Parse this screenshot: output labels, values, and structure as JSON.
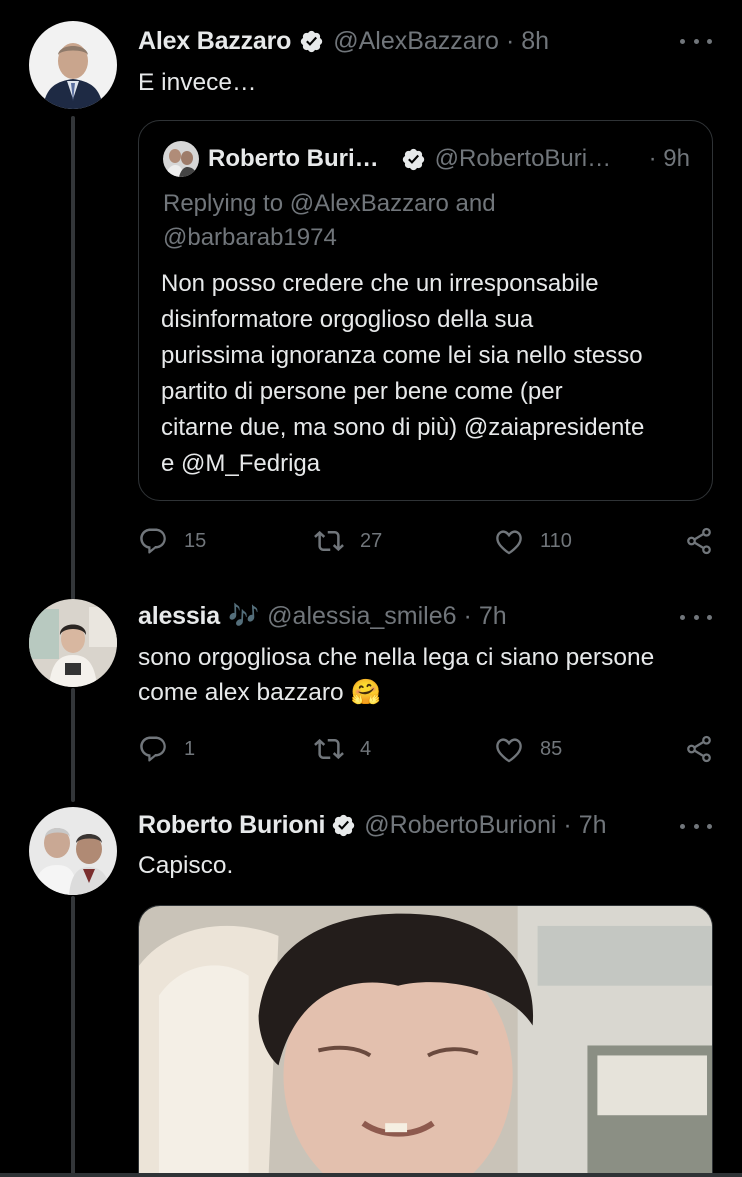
{
  "tweets": [
    {
      "name": "Alex Bazzaro",
      "handle": "@AlexBazzaro",
      "sep": "·",
      "time": "8h",
      "text": "E invece…",
      "quote": {
        "name": "Roberto Buri…",
        "handle": "@RobertoBuri…",
        "time": "· 9h",
        "replying_to_line1": "Replying to @AlexBazzaro and",
        "replying_to_line2": "@barbarab1974",
        "lines": [
          "Non posso credere che un irresponsabile",
          "disinformatore orgoglioso della sua",
          "purissima ignoranza come lei sia nello stesso",
          "partito di persone per bene come (per",
          "citarne due, ma sono di più) @zaiapresidente",
          "e @M_Fedriga"
        ]
      },
      "replies": "15",
      "retweets": "27",
      "likes": "110"
    },
    {
      "name": "alessia",
      "name_emoji": "🎶",
      "handle": "@alessia_smile6",
      "sep": "·",
      "time": "7h",
      "lines": [
        "sono orgogliosa che nella lega ci siano persone",
        "come alex bazzaro"
      ],
      "trailing_emoji": "🤗",
      "replies": "1",
      "retweets": "4",
      "likes": "85"
    },
    {
      "name": "Roberto Burioni",
      "handle": "@RobertoBurioni",
      "sep": "·",
      "time": "7h",
      "text": "Capisco."
    }
  ],
  "colors": {
    "background": "#000000",
    "text": "#e7e9ea",
    "muted": "#71767b",
    "verified": "#e7e9ea",
    "border": "#2f3336"
  },
  "icons": [
    "verified-badge-icon",
    "more-icon",
    "reply-icon",
    "retweet-icon",
    "like-icon",
    "share-icon",
    "music-notes-emoji",
    "hugging-face-emoji"
  ]
}
